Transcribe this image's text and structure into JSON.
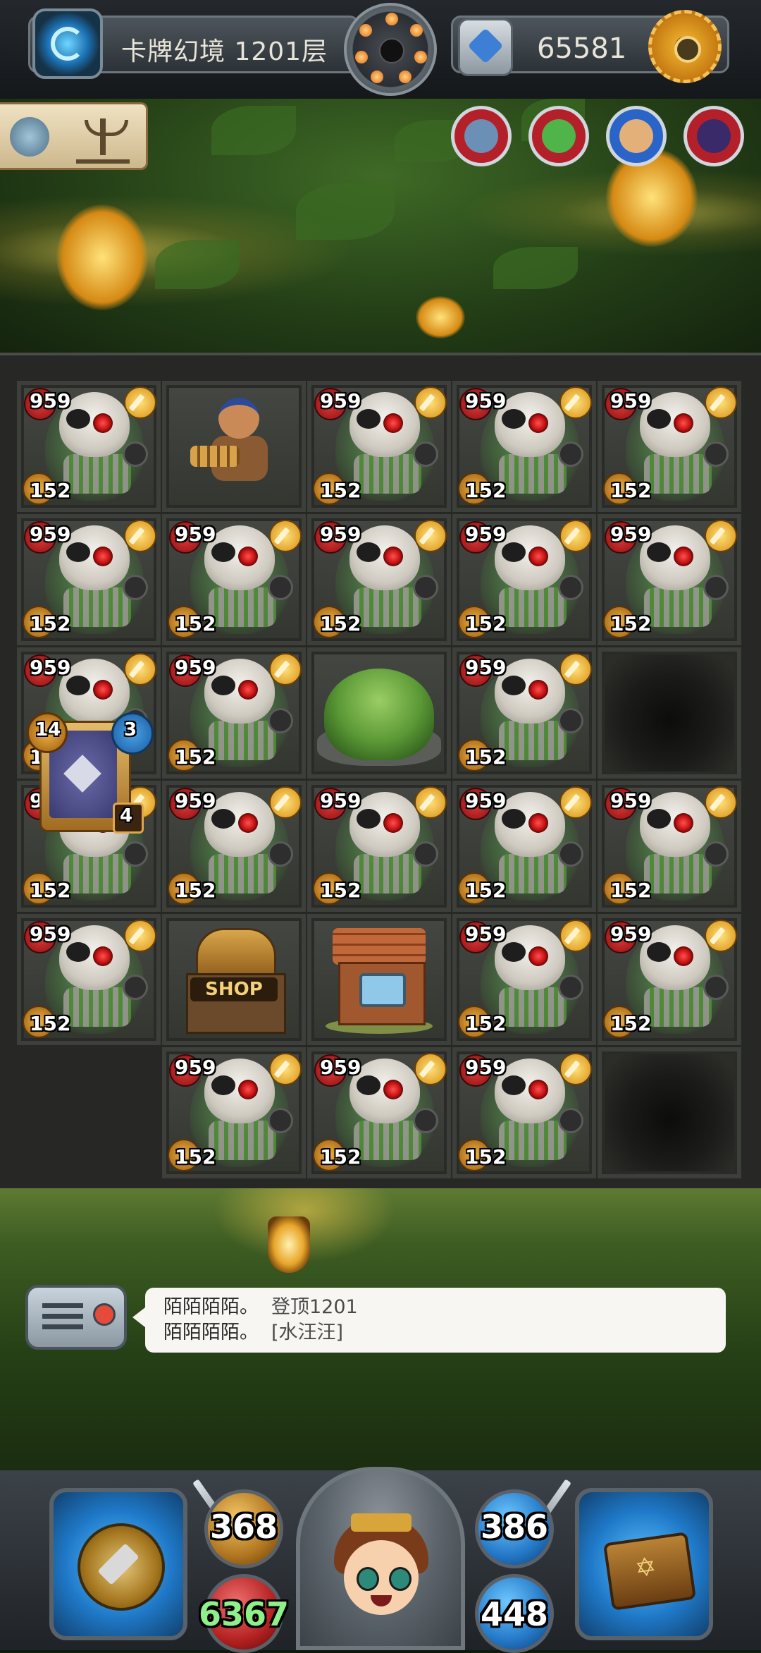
{
  "header": {
    "floor_title": "卡牌幻境 1201层",
    "coins": "65581",
    "floor_icon": "portal-swirl-icon",
    "bomb_icon": "bomb-wheel-icon",
    "gem_icon": "gem-shield-icon",
    "settings_icon": "gear-icon"
  },
  "buffs": [
    "turtle-shell-icon",
    "winged-scepter-icon"
  ],
  "heroes": [
    {
      "name": "hero-hammer-icon",
      "color": "#b3202a"
    },
    {
      "name": "hero-goblin-icon",
      "color": "#b3202a"
    },
    {
      "name": "hero-pirate-icon",
      "color": "#2a64c8"
    },
    {
      "name": "hero-demon-icon",
      "color": "#b3202a"
    }
  ],
  "monster": {
    "type": "skeleton-pirate",
    "attack": "959",
    "hp": "152"
  },
  "board": {
    "rows": [
      [
        "monster",
        "warrior",
        "monster",
        "monster",
        "monster"
      ],
      [
        "monster",
        "monster",
        "monster",
        "monster",
        "monster"
      ],
      [
        "monster",
        "monster",
        "bush",
        "monster",
        "hole"
      ],
      [
        "monster",
        "monster",
        "monster",
        "monster",
        "monster"
      ],
      [
        "monster",
        "shop",
        "house",
        "monster",
        "monster"
      ],
      [
        "deck",
        "monster",
        "monster",
        "monster",
        "hole"
      ]
    ]
  },
  "shop": {
    "label": "SHOP"
  },
  "deck": {
    "left_badge": "14",
    "right_badge": "3",
    "bottom_badge": "4"
  },
  "chat": {
    "messages": [
      {
        "name": "陌陌陌陌。",
        "text": "登顶1201"
      },
      {
        "name": "陌陌陌陌。",
        "text": "[水汪汪]"
      }
    ]
  },
  "stats": {
    "attack": "368",
    "defense": "386",
    "hp": "6367",
    "magic": "448"
  }
}
